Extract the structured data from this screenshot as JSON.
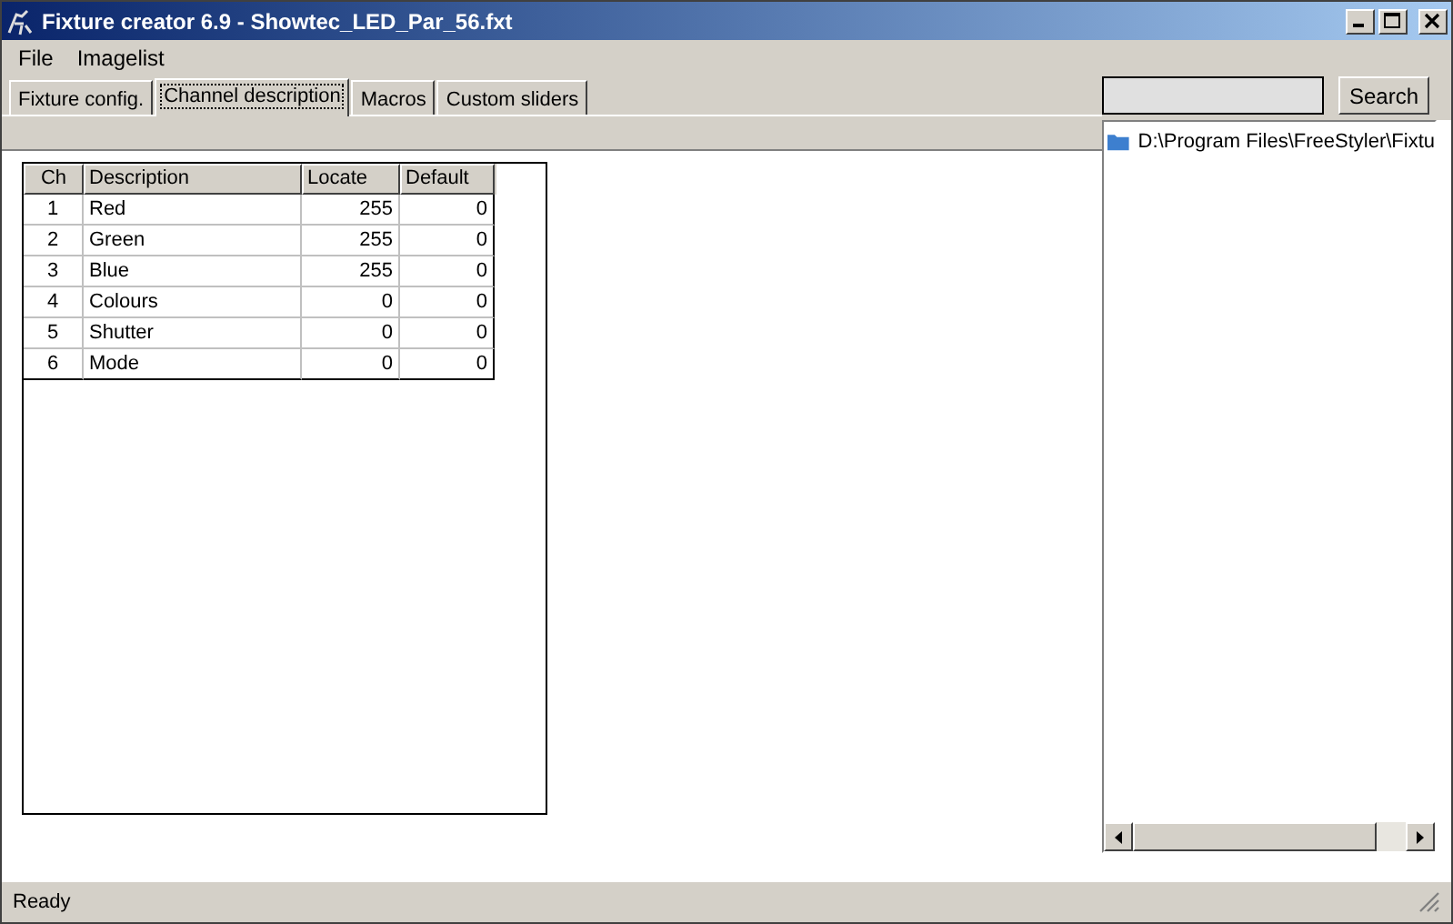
{
  "window": {
    "title": "Fixture creator 6.9 - Showtec_LED_Par_56.fxt"
  },
  "menu": [
    "File",
    "Imagelist"
  ],
  "tabs": [
    {
      "label": "Fixture config.",
      "selected": false
    },
    {
      "label": "Channel description",
      "selected": true
    },
    {
      "label": "Macros",
      "selected": false
    },
    {
      "label": "Custom sliders",
      "selected": false
    }
  ],
  "table": {
    "columns": [
      "Ch",
      "Description",
      "Locate",
      "Default"
    ],
    "rows": [
      [
        "1",
        "Red",
        "255",
        "0"
      ],
      [
        "2",
        "Green",
        "255",
        "0"
      ],
      [
        "3",
        "Blue",
        "255",
        "0"
      ],
      [
        "4",
        "Colours",
        "0",
        "0"
      ],
      [
        "5",
        "Shutter",
        "0",
        "0"
      ],
      [
        "6",
        "Mode",
        "0",
        "0"
      ]
    ]
  },
  "search": {
    "button": "Search"
  },
  "tree": {
    "items": [
      {
        "label": "D:\\Program Files\\FreeStyler\\Fixtu"
      }
    ]
  },
  "status_bar": "Ready"
}
